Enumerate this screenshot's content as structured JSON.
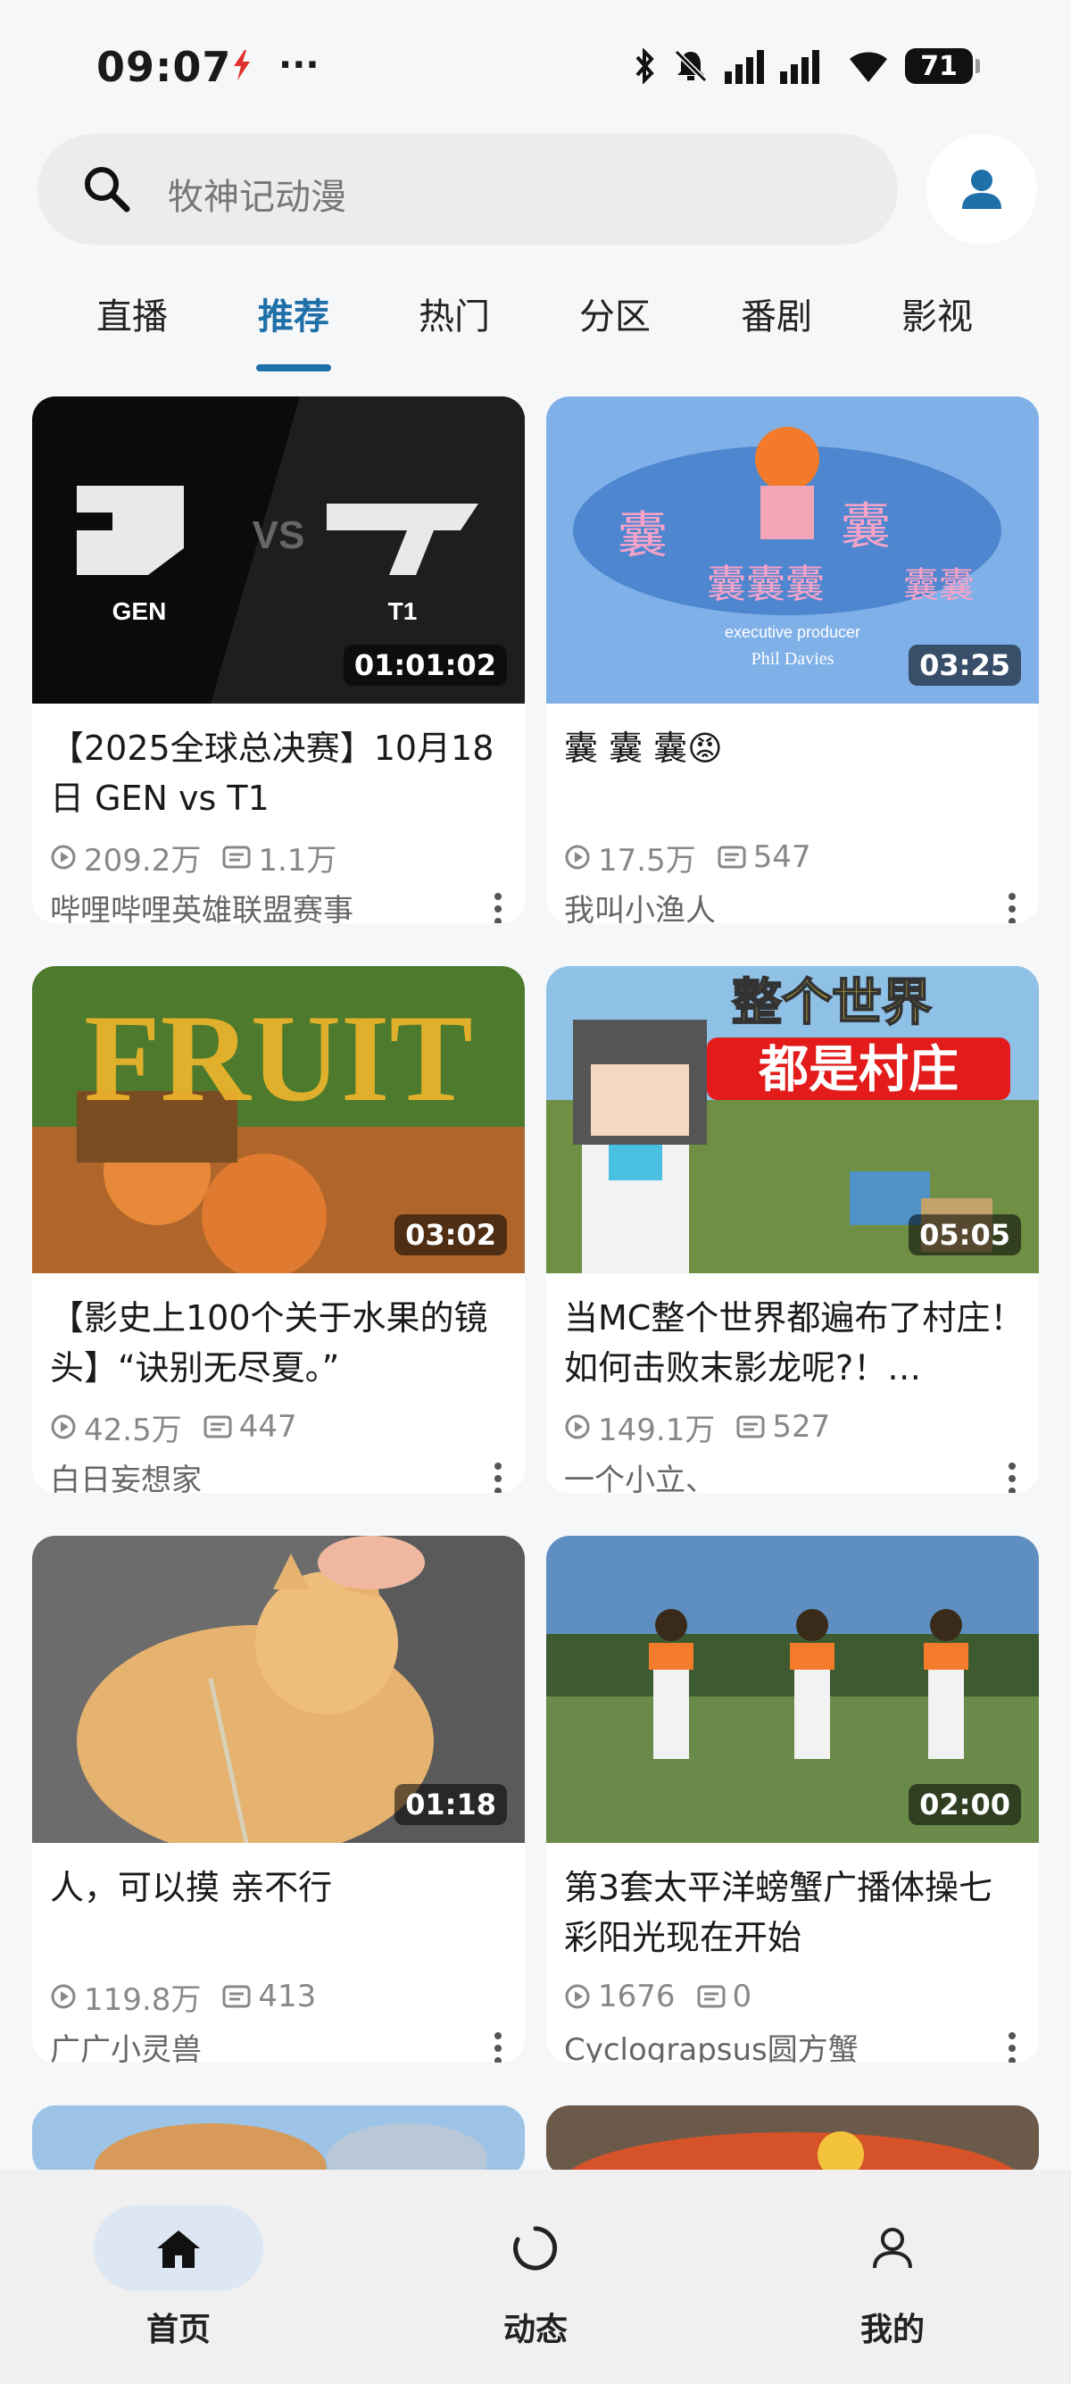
{
  "status": {
    "time": "09:07",
    "more": "···",
    "battery": "71",
    "icons": [
      "bluetooth-icon",
      "mute-icon",
      "signal-icon",
      "wifi-icon",
      "battery-icon"
    ]
  },
  "search": {
    "placeholder": "牧神记动漫"
  },
  "tabs": [
    {
      "label": "直播"
    },
    {
      "label": "推荐"
    },
    {
      "label": "热门"
    },
    {
      "label": "分区"
    },
    {
      "label": "番剧"
    },
    {
      "label": "影视"
    }
  ],
  "active_tab": "推荐",
  "feed": [
    {
      "title": "【2025全球总决赛】10月18日 GEN vs T1",
      "duration": "01:01:02",
      "views": "209.2万",
      "comments": "1.1万",
      "author": "哔哩哔哩英雄联盟赛事",
      "thumb_text": [
        "GEN",
        "VS",
        "T1"
      ]
    },
    {
      "title": "囊 囊 囊😡",
      "duration": "03:25",
      "views": "17.5万",
      "comments": "547",
      "author": "我叫小渔人",
      "thumb_text": [
        "囊",
        "executive producer",
        "Phil Davies"
      ]
    },
    {
      "title": "【影史上100个关于水果的镜头】“诀别无尽夏。”",
      "duration": "03:02",
      "views": "42.5万",
      "comments": "447",
      "author": "白日妄想家",
      "thumb_text": [
        "FRUIT"
      ]
    },
    {
      "title": "当MC整个世界都遍布了村庄！如何击败末影龙呢?！…",
      "duration": "05:05",
      "views": "149.1万",
      "comments": "527",
      "author": "一个小立、",
      "thumb_text": [
        "整个世界",
        "都是村庄"
      ]
    },
    {
      "title": "人，可以摸 亲不行",
      "duration": "01:18",
      "views": "119.8万",
      "comments": "413",
      "author": "广广小灵兽",
      "thumb_text": []
    },
    {
      "title": "第3套太平洋螃蟹广播体操七彩阳光现在开始",
      "duration": "02:00",
      "views": "1676",
      "comments": "0",
      "author": "Cyclograpsus圆方蟹",
      "thumb_text": []
    }
  ],
  "bottom_nav": [
    {
      "label": "首页",
      "icon": "home-icon"
    },
    {
      "label": "动态",
      "icon": "activity-icon"
    },
    {
      "label": "我的",
      "icon": "profile-icon"
    }
  ],
  "colors": {
    "accent": "#1f6fa8",
    "background": "#f6f7f9"
  }
}
